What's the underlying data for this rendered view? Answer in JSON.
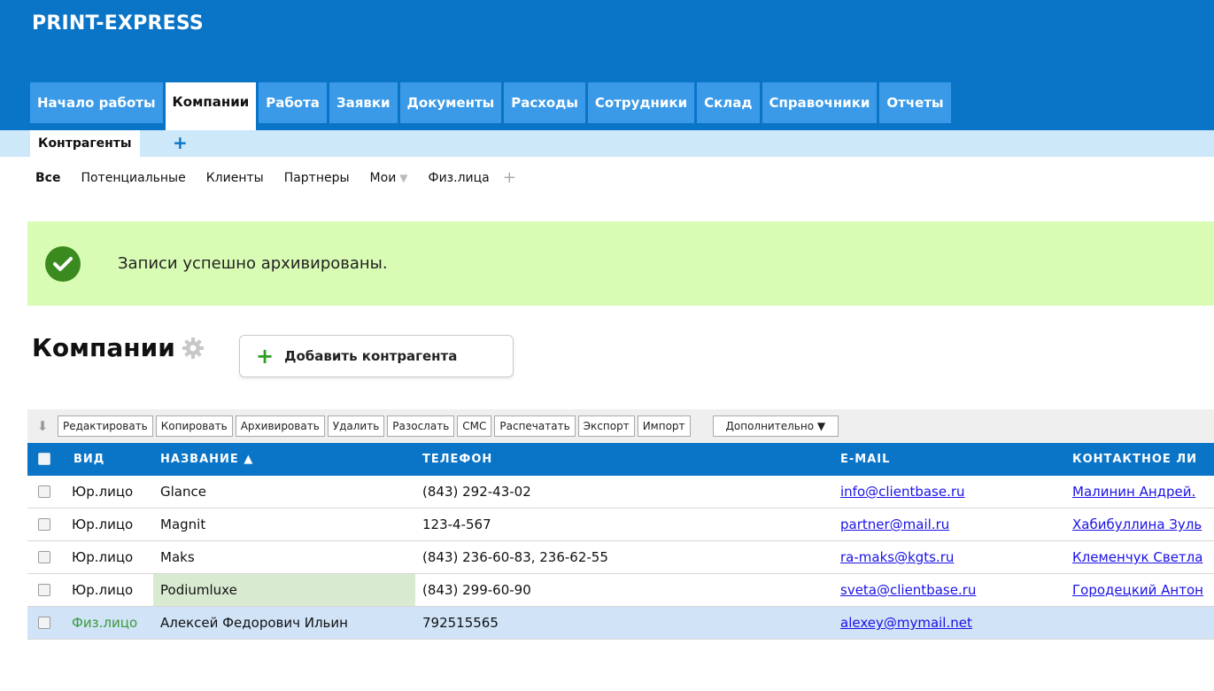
{
  "app": {
    "title": "PRINT-EXPRESS"
  },
  "main_tabs": [
    {
      "label": "Начало работы",
      "active": false
    },
    {
      "label": "Компании",
      "active": true
    },
    {
      "label": "Работа",
      "active": false
    },
    {
      "label": "Заявки",
      "active": false
    },
    {
      "label": "Документы",
      "active": false
    },
    {
      "label": "Расходы",
      "active": false
    },
    {
      "label": "Сотрудники",
      "active": false
    },
    {
      "label": "Склад",
      "active": false
    },
    {
      "label": "Справочники",
      "active": false
    },
    {
      "label": "Отчеты",
      "active": false
    }
  ],
  "sub_tabs": {
    "active": "Контрагенты",
    "add": "+"
  },
  "filters": {
    "all": "Все",
    "potential": "Потенциальные",
    "clients": "Клиенты",
    "partners": "Партнеры",
    "mine": "Мои",
    "mine_arrow": "▼",
    "individuals": "Физ.лица",
    "add": "+"
  },
  "alert": {
    "message": "Записи успешно архивированы.",
    "icon": "check-circle-icon",
    "color": "#d9fcb5"
  },
  "page": {
    "title": "Компании",
    "settings_icon": "gear-icon",
    "add_button": "Добавить контрагента",
    "add_icon": "plus-icon"
  },
  "toolbar": {
    "sort_icon": "download-arrow-icon",
    "edit": "Редактировать",
    "copy": "Копировать",
    "archive": "Архивировать",
    "delete": "Удалить",
    "send": "Разослать",
    "sms": "СМС",
    "print": "Распечатать",
    "export": "Экспорт",
    "import": "Импорт",
    "more": "Дополнительно ▼"
  },
  "table": {
    "columns": {
      "kind": "ВИД",
      "name": "НАЗВАНИЕ ▲",
      "phone": "ТЕЛЕФОН",
      "email": "E-MAIL",
      "contact": "КОНТАКТНОЕ ЛИ"
    },
    "rows": [
      {
        "kind": "Юр.лицо",
        "name": "Glance",
        "phone": "(843) 292-43-02",
        "email": "info@clientbase.ru",
        "contact": "Малинин Андрей."
      },
      {
        "kind": "Юр.лицо",
        "name": "Magnit",
        "phone": "123-4-567",
        "email": "partner@mail.ru",
        "contact": "Хабибуллина Зуль"
      },
      {
        "kind": "Юр.лицо",
        "name": "Maks",
        "phone": "(843) 236-60-83, 236-62-55",
        "email": "ra-maks@kgts.ru",
        "contact": "Клеменчук Светла"
      },
      {
        "kind": "Юр.лицо",
        "name": "Podiumluxe",
        "phone": "(843) 299-60-90",
        "email": "sveta@clientbase.ru",
        "contact": "Городецкий Антон"
      },
      {
        "kind": "Физ.лицо",
        "name": "Алексей Федорович Ильин",
        "phone": "792515565",
        "email": "alexey@mymail.net",
        "contact": ""
      }
    ]
  },
  "colors": {
    "brand": "#0a74c7",
    "tab": "#3a9ae8",
    "subbar": "#cde8f9",
    "link": "#1a12e6",
    "success": "#3b8a1f"
  }
}
